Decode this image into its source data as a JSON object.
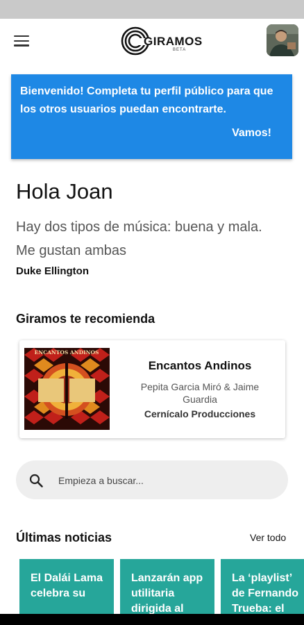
{
  "header": {
    "menu_icon": "hamburger-menu-icon",
    "logo": {
      "text": "GIRAMOS",
      "badge": "BETA"
    },
    "avatar_icon": "user-avatar"
  },
  "banner": {
    "message": "Bienvenido! Completa tu perfil público para que los otros usuarios puedan encontrarte.",
    "action_label": "Vamos!",
    "color": "#1e88e5"
  },
  "greeting": "Hola Joan",
  "quote": {
    "text": "Hay dos tipos de música: buena y mala. Me gustan ambas",
    "author": "Duke Ellington"
  },
  "recommendation": {
    "section_title": "Giramos te recomienda",
    "title": "Encantos Andinos",
    "artist": "Pepita Garcia Miró & Jaime Guardia",
    "label": "Cernícalo Producciones",
    "cover_text": "ENCANTOS ANDINOS"
  },
  "search": {
    "placeholder": "Empieza a buscar...",
    "value": "",
    "icon": "search-icon"
  },
  "news": {
    "section_title": "Últimas noticias",
    "see_all_label": "Ver todo",
    "color": "#26a69a",
    "items": [
      {
        "title": "El Dalái Lama celebra su"
      },
      {
        "title": "Lanzarán app utilitaria dirigida al"
      },
      {
        "title": "La ‘playlist’ de Fernando Trueba: el"
      }
    ]
  }
}
